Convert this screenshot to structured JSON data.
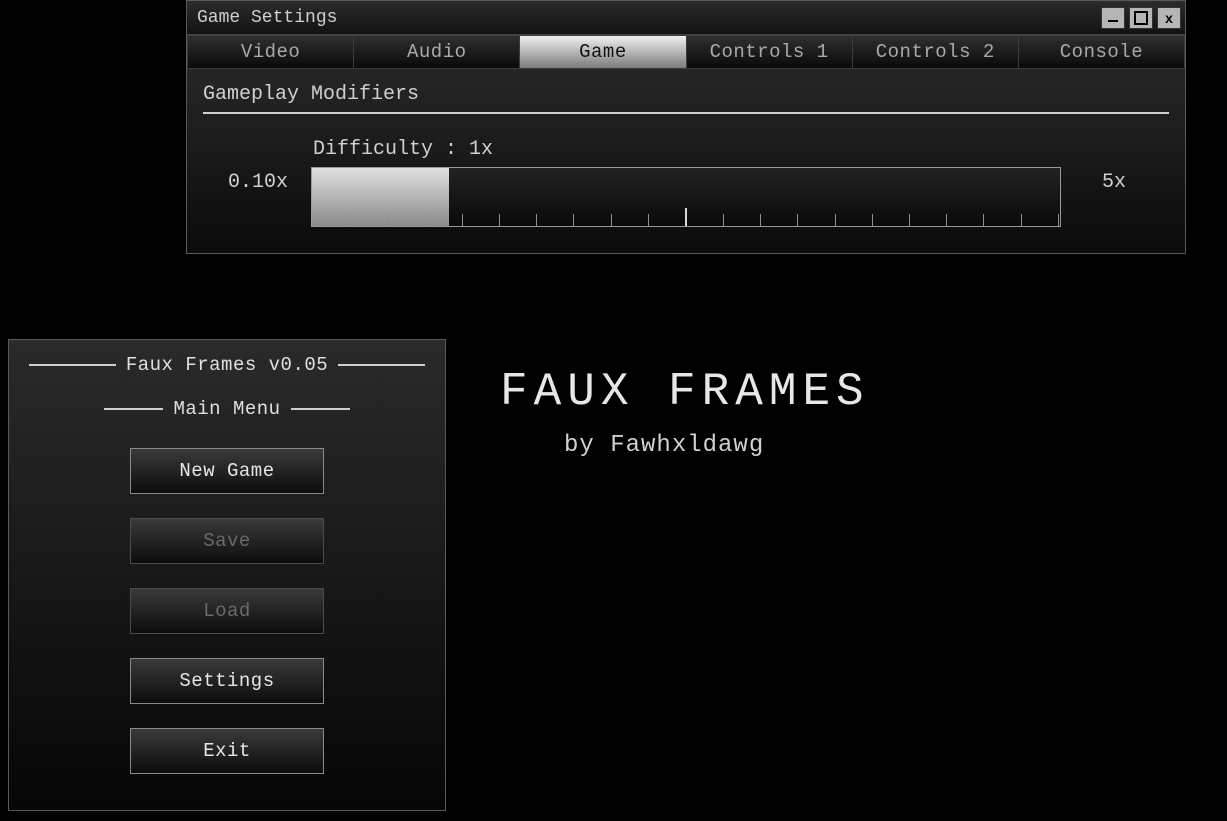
{
  "settings": {
    "window_title": "Game Settings",
    "tabs": [
      {
        "label": "Video",
        "active": false
      },
      {
        "label": "Audio",
        "active": false
      },
      {
        "label": "Game",
        "active": true
      },
      {
        "label": "Controls 1",
        "active": false
      },
      {
        "label": "Controls 2",
        "active": false
      },
      {
        "label": "Console",
        "active": false
      }
    ],
    "section_title": "Gameplay Modifiers",
    "difficulty": {
      "label": "Difficulty : 1x",
      "min_label": "0.10x",
      "max_label": "5x",
      "min": 0.1,
      "max": 5.0,
      "value": 1.0,
      "tick_count": 21,
      "major_tick_index": 10
    },
    "window_buttons": {
      "close_label": "x"
    }
  },
  "menu": {
    "title": "Faux Frames v0.05",
    "subtitle": "Main Menu",
    "items": [
      {
        "label": "New Game",
        "enabled": true
      },
      {
        "label": "Save",
        "enabled": false
      },
      {
        "label": "Load",
        "enabled": false
      },
      {
        "label": "Settings",
        "enabled": true
      },
      {
        "label": "Exit",
        "enabled": true
      }
    ]
  },
  "background": {
    "title": "FAUX FRAMES",
    "credit": "by Fawhxldawg"
  }
}
